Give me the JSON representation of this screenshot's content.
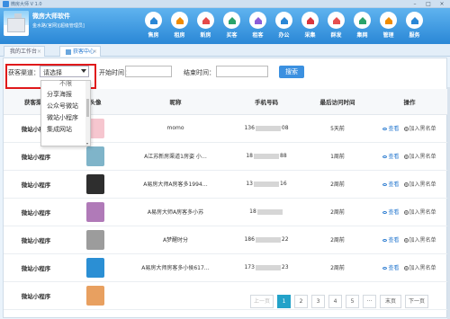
{
  "window": {
    "title": "微房大师 V 1.0"
  },
  "brand": {
    "name": "微房大师软件",
    "subtitle": "金水路(官网)[超级管理员]"
  },
  "nav": [
    {
      "label": "售房",
      "icon": "home-icon",
      "color": "#2a87d6"
    },
    {
      "label": "租房",
      "icon": "home-rent-icon",
      "color": "#f08c00"
    },
    {
      "label": "新房",
      "icon": "building-icon",
      "color": "#e64a4a"
    },
    {
      "label": "买客",
      "icon": "buyer-icon",
      "color": "#2aa36b"
    },
    {
      "label": "租客",
      "icon": "tenant-icon",
      "color": "#8c5cd8"
    },
    {
      "label": "办公",
      "icon": "office-icon",
      "color": "#2a87d6"
    },
    {
      "label": "采集",
      "icon": "collect-icon",
      "color": "#d9363e"
    },
    {
      "label": "群发",
      "icon": "send-icon",
      "color": "#e65050"
    },
    {
      "label": "集网",
      "icon": "network-icon",
      "color": "#2aa36b"
    },
    {
      "label": "管理",
      "icon": "gear-icon",
      "color": "#f08c00"
    },
    {
      "label": "服务",
      "icon": "service-icon",
      "color": "#2a87d6"
    }
  ],
  "tabs": [
    {
      "label": "我的工作台"
    },
    {
      "label": "获客中心"
    }
  ],
  "filters": {
    "channel_label": "获客渠道：",
    "channel_value": "请选择",
    "start_label": "开始时间：",
    "start_placeholder": "",
    "end_label": "结束时间：",
    "end_placeholder": "",
    "search_label": "搜索"
  },
  "dropdown": {
    "options": [
      "不限",
      "分享海报",
      "公众号微站",
      "微站小程序",
      "集成网站"
    ]
  },
  "table": {
    "headers": [
      "获客渠道",
      "头像",
      "昵称",
      "手机号码",
      "最后访问时间",
      "操作"
    ],
    "rows": [
      {
        "channel": "微站小程序",
        "nickname": "momo",
        "phone": "136",
        "phone_tail": "08",
        "time": "5天前",
        "avatar_color": "#f6c6cf"
      },
      {
        "channel": "微站小程序",
        "nickname": "A江苏新房渠道1房姿 小…",
        "phone": "18",
        "phone_tail": "88",
        "time": "1周前",
        "avatar_color": "#7fb4c9"
      },
      {
        "channel": "微站小程序",
        "nickname": "A易房大师A房客多1994…",
        "phone": "13",
        "phone_tail": "16",
        "time": "2周前",
        "avatar_color": "#2e2e2e"
      },
      {
        "channel": "微站小程序",
        "nickname": "A易房大师A房客多小苏",
        "phone": "18",
        "phone_tail": "",
        "time": "2周前",
        "avatar_color": "#b07ab8"
      },
      {
        "channel": "微站小程序",
        "nickname": "A梦醒时分",
        "phone": "186",
        "phone_tail": "22",
        "time": "2周前",
        "avatar_color": "#9c9c9c"
      },
      {
        "channel": "微站小程序",
        "nickname": "A易房大师房客多小侯617…",
        "phone": "173",
        "phone_tail": "23",
        "time": "2周前",
        "avatar_color": "#2b8fd4"
      },
      {
        "channel": "微站小程序",
        "nickname": "",
        "phone": "",
        "phone_tail": "",
        "time": "",
        "avatar_color": "#e8a060"
      }
    ],
    "view_label": "查看",
    "black_label": "加入黑名单"
  },
  "pager": {
    "prev": "上一页",
    "pages": [
      "1",
      "2",
      "3",
      "4",
      "5",
      "···"
    ],
    "last": "末页",
    "next": "下一页",
    "current": "1"
  }
}
